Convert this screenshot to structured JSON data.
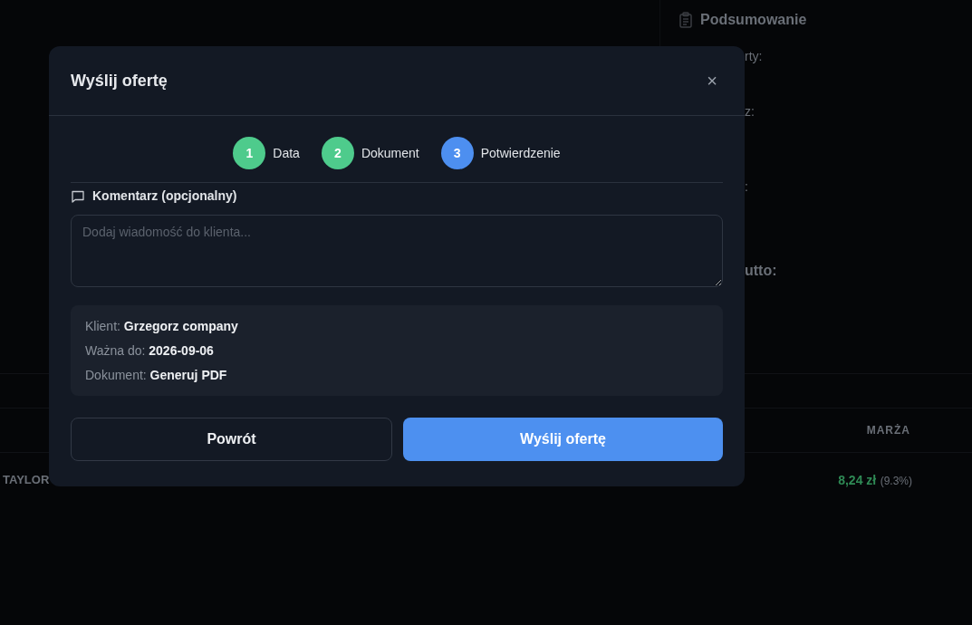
{
  "background": {
    "summary": {
      "title": "Podsumowanie",
      "fragments": [
        "rty:",
        "z:",
        ":",
        "utto:"
      ]
    },
    "table": {
      "column_header": "MARŻA",
      "row": {
        "name": "TAYLOR",
        "margin": "8,24 zł",
        "margin_percent": "(9.3%)"
      }
    }
  },
  "dialog": {
    "title": "Wyślij ofertę",
    "close": "×",
    "steps": [
      {
        "number": "1",
        "label": "Data",
        "kind": "done"
      },
      {
        "number": "2",
        "label": "Dokument",
        "kind": "done"
      },
      {
        "number": "3",
        "label": "Potwierdzenie",
        "kind": "current"
      }
    ],
    "comment": {
      "label": "Komentarz (opcjonalny)",
      "placeholder": "Dodaj wiadomość do klienta..."
    },
    "summary": [
      {
        "label": "Klient:",
        "value": "Grzegorz company"
      },
      {
        "label": "Ważna do:",
        "value": "2026-09-06"
      },
      {
        "label": "Dokument:",
        "value": "Generuj PDF"
      }
    ],
    "buttons": {
      "back": "Powrót",
      "submit": "Wyślij ofertę"
    }
  }
}
